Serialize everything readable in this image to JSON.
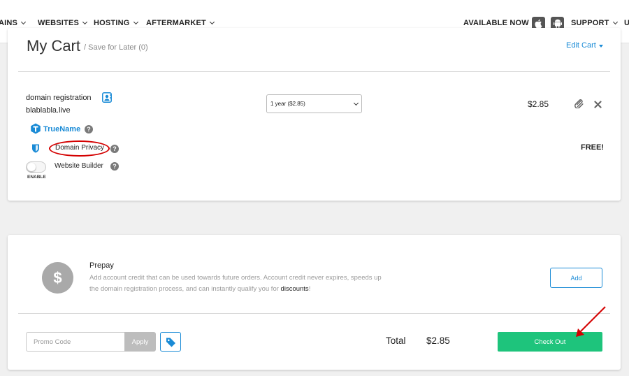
{
  "nav": {
    "items": [
      {
        "label": "AINS"
      },
      {
        "label": "WEBSITES"
      },
      {
        "label": "HOSTING"
      },
      {
        "label": "AFTERMARKET"
      }
    ],
    "available_now": "AVAILABLE NOW",
    "support": "SUPPORT",
    "cut_item": "U"
  },
  "cart": {
    "title": "My Cart",
    "save_for_later": "/ Save for Later (0)",
    "edit_cart": "Edit Cart",
    "item": {
      "type": "domain registration",
      "domain": "blablabla.live",
      "period_select": "1 year ($2.85)",
      "price": "$2.85"
    },
    "truename": "TrueName",
    "domain_privacy": "Domain Privacy",
    "domain_privacy_price": "FREE!",
    "website_builder": "Website Builder",
    "toggle_label": "ENABLE"
  },
  "prepay": {
    "symbol": "$",
    "title": "Prepay",
    "description": "Add account credit that can be used towards future orders. Account credit never expires, speeds up the domain registration process, and can instantly qualify you for",
    "discounts": "discounts",
    "suffix": "!",
    "add_label": "Add"
  },
  "checkout": {
    "promo_placeholder": "Promo Code",
    "apply_label": "Apply",
    "total_label": "Total",
    "total_value": "$2.85",
    "checkout_label": "Check Out"
  },
  "colors": {
    "accent": "#1a8bd6",
    "checkout_green": "#1ec47c",
    "annotation_red": "#d40000"
  }
}
